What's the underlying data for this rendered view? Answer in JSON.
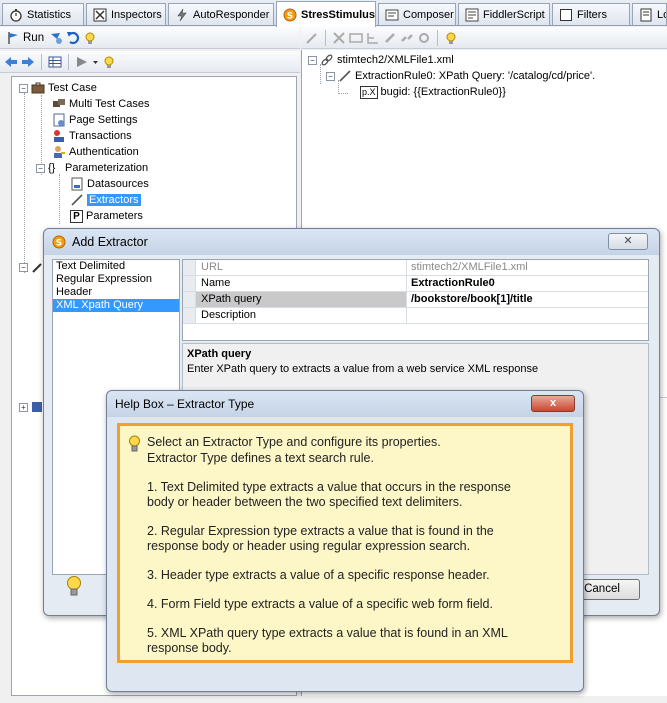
{
  "tabs": [
    {
      "label": "Statistics",
      "icon": "stopwatch-icon"
    },
    {
      "label": "Inspectors",
      "icon": "inspector-icon"
    },
    {
      "label": "AutoResponder",
      "icon": "lightning-icon"
    },
    {
      "label": "StresStimulus",
      "icon": "stresstimulus-icon"
    },
    {
      "label": "Composer",
      "icon": "composer-icon"
    },
    {
      "label": "FiddlerScript",
      "icon": "script-icon"
    },
    {
      "label": "Filters",
      "icon": "checkbox-icon"
    },
    {
      "label": "Log",
      "icon": "log-icon"
    }
  ],
  "active_tab": "StresStimulus",
  "left_toolbar": {
    "run_label": "Run"
  },
  "tree": {
    "root": "Test Case",
    "children": [
      {
        "label": "Multi Test Cases",
        "icon": "multi-icon"
      },
      {
        "label": "Page Settings",
        "icon": "page-settings-icon"
      },
      {
        "label": "Transactions",
        "icon": "transactions-icon"
      },
      {
        "label": "Authentication",
        "icon": "user-key-icon"
      },
      {
        "label": "Parameterization",
        "icon": "braces-icon",
        "children": [
          "Datasources",
          "Extractors",
          "Parameters"
        ]
      }
    ],
    "selected": "Extractors",
    "param_icon_letter": "P",
    "param_braces": "{}"
  },
  "extraction_tree": {
    "file": "stimtech2/XMLFile1.xml",
    "rule": "ExtractionRule0: XPath Query: '/catalog/cd/price'.",
    "param": "bugid: {{ExtractionRule0}}",
    "param_icon_text": "p.X"
  },
  "add_extractor": {
    "title": "Add Extractor",
    "types": [
      "Text Delimited",
      "Regular Expression",
      "Header",
      "XML Xpath Query"
    ],
    "selected_type": "XML Xpath Query",
    "properties": [
      {
        "name": "URL",
        "value": "stimtech2/XMLFile1.xml"
      },
      {
        "name": "Name",
        "value": "ExtractionRule0"
      },
      {
        "name": "XPath query",
        "value": "/bookstore/book[1]/title"
      },
      {
        "name": "Description",
        "value": ""
      }
    ],
    "desc_title": "XPath query",
    "desc_text": "Enter XPath query to extracts a value from a web service XML response",
    "cancel_label": "Cancel"
  },
  "help_box": {
    "title": "Help Box – Extractor Type",
    "close_label": "x",
    "lines": [
      "Select an Extractor Type and configure its properties.",
      "Extractor Type defines a text search rule.",
      "1. Text Delimited type extracts a value that occurs in the response",
      "body or header between the two specified text delimiters.",
      "2. Regular Expression type extracts a value that is found in the",
      "response body or header using regular expression search.",
      "3. Header type extracts a value of a specific response header.",
      "4. Form Field type extracts a value of a specific web form field.",
      "5. XML XPath query type extracts a value that is found in an XML",
      "response body."
    ]
  },
  "colors": {
    "selection": "#3399ff",
    "help_border": "#f0a030",
    "help_background": "#fdf6c7"
  }
}
